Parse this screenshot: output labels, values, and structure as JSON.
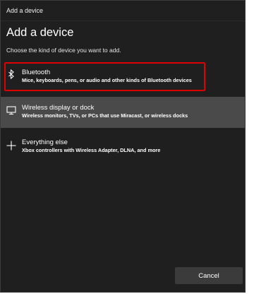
{
  "window": {
    "title": "Add a device"
  },
  "header": {
    "title": "Add a device",
    "subtitle": "Choose the kind of device you want to add."
  },
  "options": [
    {
      "icon": "bluetooth-icon",
      "title": "Bluetooth",
      "description": "Mice, keyboards, pens, or audio and other kinds of Bluetooth devices",
      "highlighted": true
    },
    {
      "icon": "monitor-icon",
      "title": "Wireless display or dock",
      "description": "Wireless monitors, TVs, or PCs that use Miracast, or wireless docks",
      "hovered": true
    },
    {
      "icon": "plus-icon",
      "title": "Everything else",
      "description": "Xbox controllers with Wireless Adapter, DLNA, and more"
    }
  ],
  "footer": {
    "cancel_label": "Cancel"
  },
  "colors": {
    "background": "#1f1f1f",
    "hover": "#4a4a4a",
    "highlight_border": "#e00000",
    "button": "#3b3b3b"
  }
}
